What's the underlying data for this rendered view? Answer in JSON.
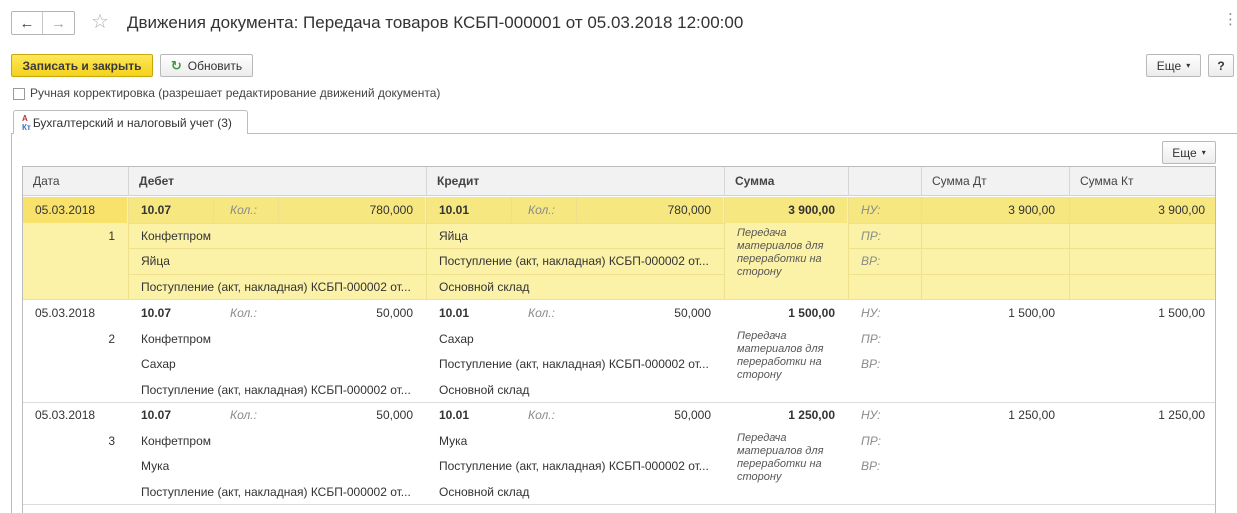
{
  "window": {
    "title": "Движения документа: Передача товаров КСБП-000001 от 05.03.2018 12:00:00",
    "back_icon": "←",
    "forward_icon": "→",
    "star_icon": "☆",
    "more_icon": "⋮"
  },
  "toolbar": {
    "save_close_label": "Записать и закрыть",
    "refresh_label": "Обновить",
    "refresh_icon": "↻",
    "more_label": "Еще",
    "help_label": "?",
    "caret": "▾"
  },
  "manual_correction": {
    "label": "Ручная корректировка (разрешает редактирование движений документа)",
    "checked": false
  },
  "tabs": [
    {
      "label": "Бухгалтерский и налоговый учет (3)",
      "active": true
    }
  ],
  "table": {
    "more_label": "Еще",
    "columns": [
      "Дата",
      "Дебет",
      "Кредит",
      "Сумма",
      "",
      "Сумма Дт",
      "Сумма Кт"
    ],
    "qty_label": "Кол.:",
    "rows": [
      {
        "date": "05.03.2018",
        "num": "1",
        "debit_account": "10.07",
        "debit_qty": "780,000",
        "debit_sub1": "Конфетпром",
        "debit_sub2": "Яйца",
        "debit_sub3": "Поступление (акт, накладная) КСБП-000002 от...",
        "credit_account": "10.01",
        "credit_qty": "780,000",
        "credit_sub1": "Яйца",
        "credit_sub2": "Поступление (акт, накладная) КСБП-000002 от...",
        "credit_sub3": "Основной склад",
        "sum": "3 900,00",
        "content": "Передача материалов для переработки на сторону",
        "nu": "НУ:",
        "pr": "ПР:",
        "vr": "ВР:",
        "sum_dt": "3 900,00",
        "sum_kt": "3 900,00",
        "selected": true
      },
      {
        "date": "05.03.2018",
        "num": "2",
        "debit_account": "10.07",
        "debit_qty": "50,000",
        "debit_sub1": "Конфетпром",
        "debit_sub2": "Сахар",
        "debit_sub3": "Поступление (акт, накладная) КСБП-000002 от...",
        "credit_account": "10.01",
        "credit_qty": "50,000",
        "credit_sub1": "Сахар",
        "credit_sub2": "Поступление (акт, накладная) КСБП-000002 от...",
        "credit_sub3": "Основной склад",
        "sum": "1 500,00",
        "content": "Передача материалов для переработки на сторону",
        "nu": "НУ:",
        "pr": "ПР:",
        "vr": "ВР:",
        "sum_dt": "1 500,00",
        "sum_kt": "1 500,00",
        "selected": false
      },
      {
        "date": "05.03.2018",
        "num": "3",
        "debit_account": "10.07",
        "debit_qty": "50,000",
        "debit_sub1": "Конфетпром",
        "debit_sub2": "Мука",
        "debit_sub3": "Поступление (акт, накладная) КСБП-000002 от...",
        "credit_account": "10.01",
        "credit_qty": "50,000",
        "credit_sub1": "Мука",
        "credit_sub2": "Поступление (акт, накладная) КСБП-000002 от...",
        "credit_sub3": "Основной склад",
        "sum": "1 250,00",
        "content": "Передача материалов для переработки на сторону",
        "nu": "НУ:",
        "pr": "ПР:",
        "vr": "ВР:",
        "sum_dt": "1 250,00",
        "sum_kt": "1 250,00",
        "selected": false
      }
    ]
  }
}
